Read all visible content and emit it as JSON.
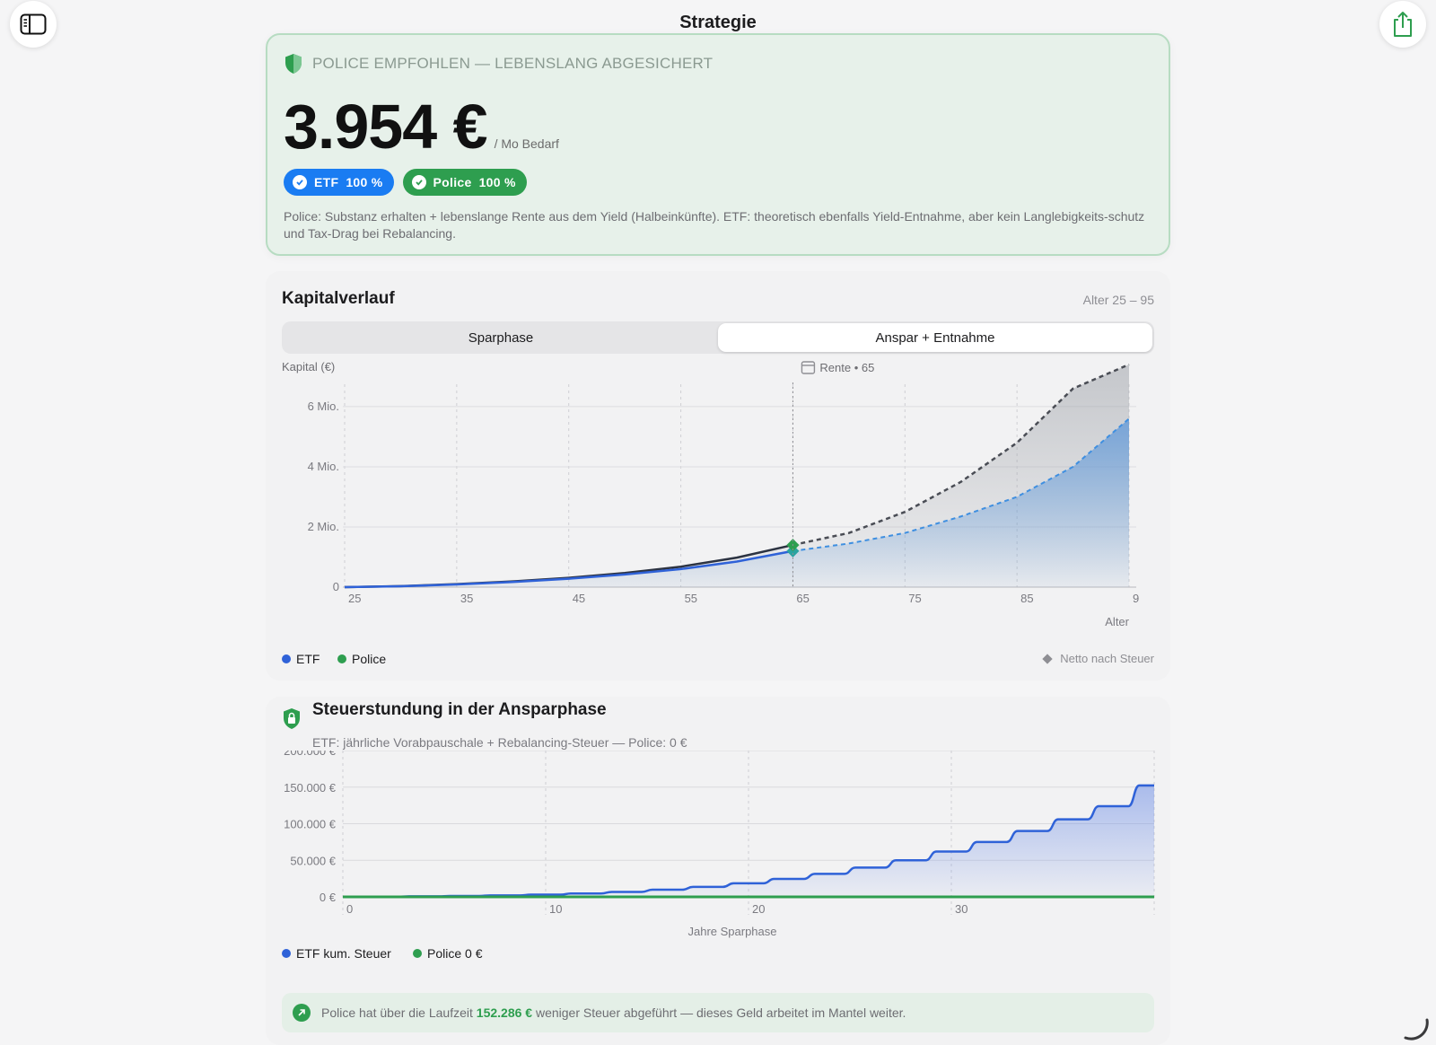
{
  "nav": {
    "title": "Strategie",
    "sidebar_icon": "sidebar-icon",
    "share_icon": "share-icon"
  },
  "hero": {
    "headline": "POLICE EMPFOHLEN — LEBENSLANG ABGESICHERT",
    "amount": "3.954 €",
    "amount_unit": "/ Mo Bedarf",
    "pills": [
      {
        "label": "ETF",
        "value": "100 %",
        "color": "#1a7cf2"
      },
      {
        "label": "Police",
        "value": "100 %",
        "color": "#2e9e4f"
      }
    ],
    "note": "Police: Substanz erhalten + lebenslange Rente aus dem Yield (Halbeinkünfte). ETF: theoretisch ebenfalls Yield-Entnahme, aber kein Langlebigkeits-schutz und Tax-Drag bei Rebalancing."
  },
  "capital": {
    "title": "Kapitalverlauf",
    "range": "Alter 25 – 95",
    "segments": [
      {
        "label": "Sparphase",
        "active": false
      },
      {
        "label": "Anspar + Entnahme",
        "active": true
      }
    ],
    "legend": {
      "etf": "ETF",
      "police": "Police",
      "netto": "Netto nach Steuer"
    }
  },
  "chart_data": [
    {
      "type": "line",
      "ylabel": "Kapital (€)",
      "xlabel": "Alter",
      "annotation": "Rente • 65",
      "x_ticks": [
        "25",
        "35",
        "45",
        "55",
        "65",
        "75",
        "85",
        "9"
      ],
      "y_ticks": [
        "0",
        "2 Mio.",
        "4 Mio.",
        "6 Mio."
      ],
      "xlim": [
        25,
        95
      ],
      "ylim": [
        0,
        7400000
      ],
      "x": [
        25,
        30,
        35,
        40,
        45,
        50,
        55,
        60,
        65,
        70,
        75,
        80,
        85,
        90,
        95
      ],
      "series": [
        {
          "name": "ETF",
          "color": "#2f62d8",
          "values": [
            0,
            30000,
            90000,
            170000,
            280000,
            420000,
            600000,
            850000,
            1200000,
            1450000,
            1800000,
            2350000,
            3000000,
            4000000,
            5600000
          ]
        },
        {
          "name": "Police",
          "color": "#2e9e4f",
          "values": [
            0,
            35000,
            100000,
            190000,
            310000,
            470000,
            680000,
            980000,
            1400000,
            1800000,
            2500000,
            3500000,
            4800000,
            6600000,
            8500000
          ]
        }
      ]
    },
    {
      "type": "area",
      "xlabel": "Jahre Sparphase",
      "x_ticks": [
        "0",
        "10",
        "20",
        "30"
      ],
      "y_ticks": [
        "0 €",
        "50.000 €",
        "100.000 €",
        "150.000 €",
        "200.000 €"
      ],
      "xlim": [
        0,
        40
      ],
      "ylim": [
        0,
        200000
      ],
      "x": [
        0,
        2,
        4,
        6,
        8,
        10,
        12,
        14,
        16,
        18,
        20,
        22,
        24,
        26,
        28,
        30,
        32,
        34,
        36,
        38,
        40
      ],
      "series": [
        {
          "name": "ETF kum. Steuer",
          "color": "#2f62d8",
          "values": [
            0,
            300,
            700,
            1300,
            2000,
            3000,
            4600,
            6800,
            9800,
            13600,
            18500,
            24500,
            31500,
            40000,
            50000,
            62000,
            75000,
            90000,
            106000,
            124000,
            152286
          ]
        },
        {
          "name": "Police 0 €",
          "color": "#2e9e4f",
          "values": [
            0,
            0,
            0,
            0,
            0,
            0,
            0,
            0,
            0,
            0,
            0,
            0,
            0,
            0,
            0,
            0,
            0,
            0,
            0,
            0,
            0
          ]
        }
      ]
    }
  ],
  "tax": {
    "title": "Steuerstundung in der Ansparphase",
    "subtitle": "ETF: jährliche Vorabpauschale + Rebalancing-Steuer — Police: 0 €",
    "legend": {
      "etf": "ETF kum. Steuer",
      "police": "Police 0 €"
    },
    "banner_pre": "Police hat über die Laufzeit",
    "banner_amount": "152.286 €",
    "banner_post": "weniger Steuer abgeführt — dieses Geld arbeitet im Mantel weiter."
  }
}
